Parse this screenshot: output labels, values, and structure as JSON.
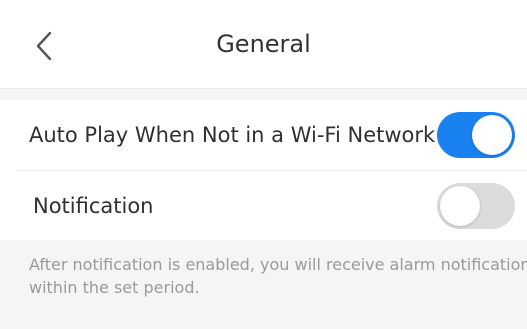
{
  "header": {
    "title": "General",
    "back_icon": "chevron-left-icon"
  },
  "settings": [
    {
      "label": "Auto Play When Not in a Wi-Fi Network",
      "enabled": true
    },
    {
      "label": "Notification",
      "enabled": false
    }
  ],
  "footnote": {
    "line1": "After notification is enabled, you will receive alarm notifications",
    "line2": "within the set period."
  },
  "colors": {
    "toggle_on": "#1a82f0",
    "toggle_off": "#dcdcdc",
    "footnote_text": "#9a9a9a"
  }
}
